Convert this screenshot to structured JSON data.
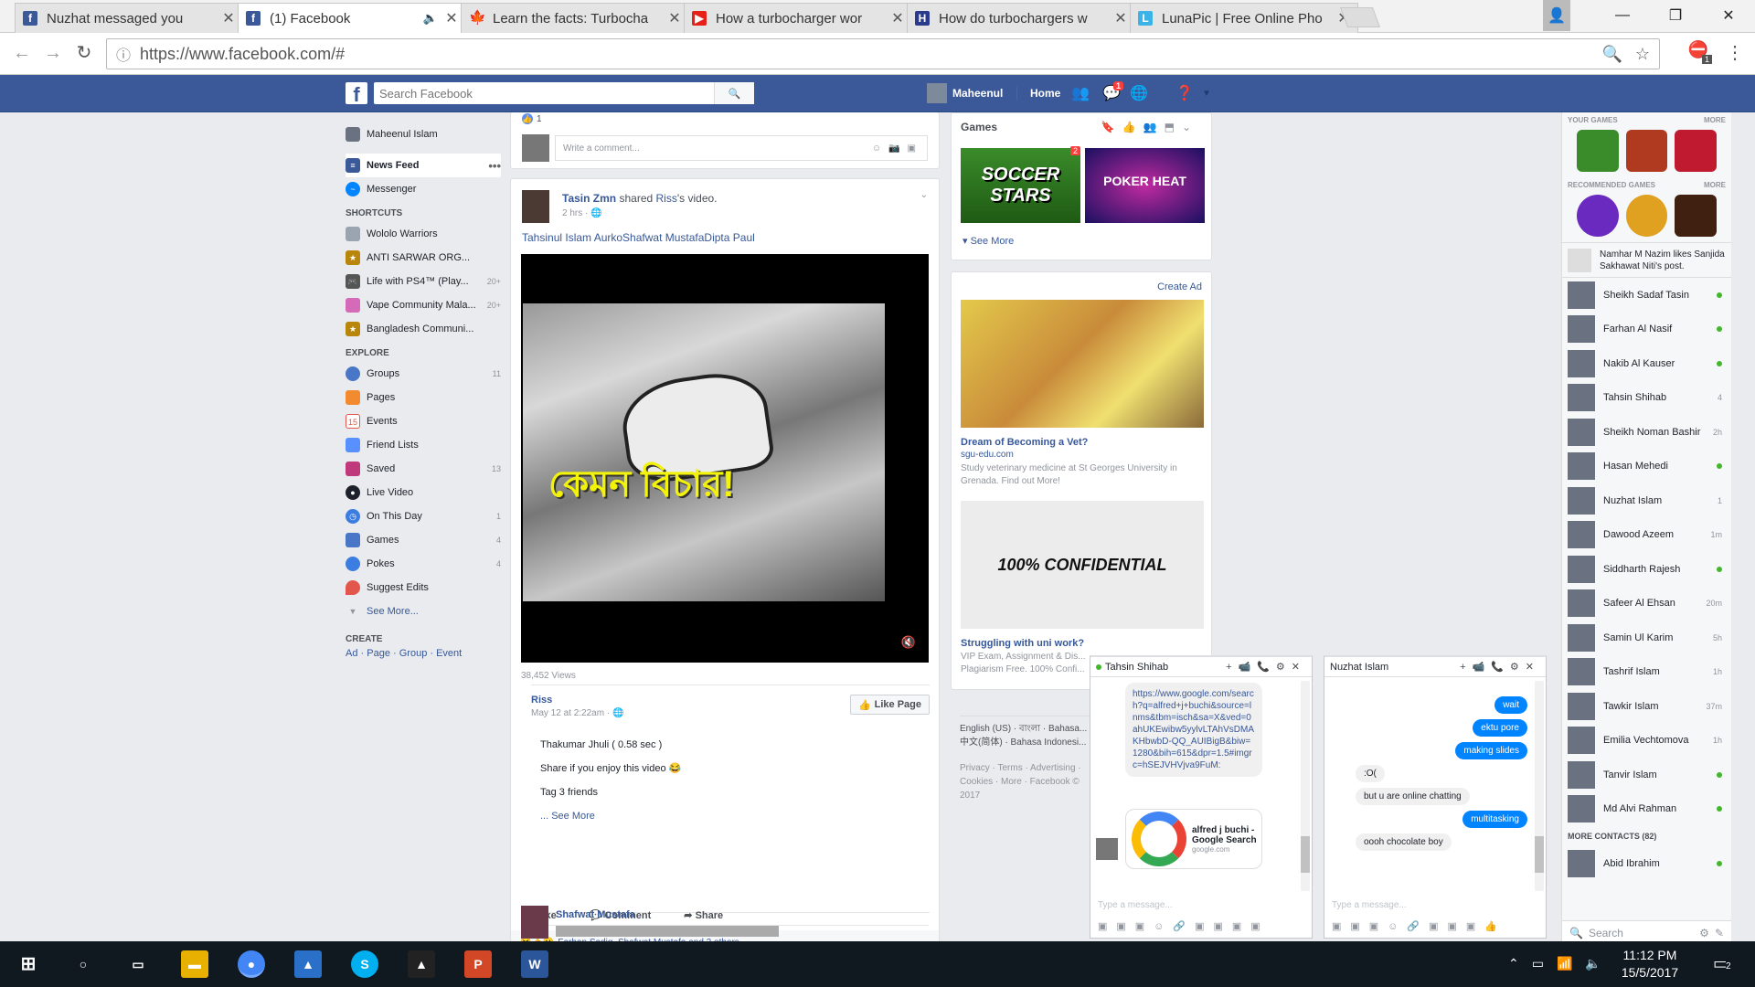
{
  "browser": {
    "tabs": [
      {
        "title": "Nuzhat messaged you",
        "icon": "facebook-icon"
      },
      {
        "title": "(1) Facebook",
        "icon": "facebook-icon",
        "active": true
      },
      {
        "title": "Learn the facts: Turbocha",
        "icon": "maple-leaf-icon"
      },
      {
        "title": "How a turbocharger wor",
        "icon": "youtube-icon"
      },
      {
        "title": "How do turbochargers w",
        "icon": "hsw-icon"
      },
      {
        "title": "LunaPic | Free Online Pho",
        "icon": "lunapic-icon"
      }
    ],
    "url": "https://www.facebook.com/#",
    "extension_badge": "1"
  },
  "fb": {
    "search_placeholder": "Search Facebook",
    "user": "Maheenul",
    "home": "Home",
    "msg_badge": "1"
  },
  "left": {
    "profile": "Maheenul Islam",
    "news_feed": "News Feed",
    "messenger": "Messenger",
    "shortcuts_head": "SHORTCUTS",
    "shortcuts": [
      {
        "label": "Wololo Warriors",
        "count": ""
      },
      {
        "label": "ANTI SARWAR ORG...",
        "count": ""
      },
      {
        "label": "Life with PS4™ (Play...",
        "count": "20+"
      },
      {
        "label": "Vape Community Mala...",
        "count": "20+"
      },
      {
        "label": "Bangladesh Communi...",
        "count": ""
      }
    ],
    "explore_head": "EXPLORE",
    "explore": [
      {
        "label": "Groups",
        "count": "11",
        "color": "#4a76c7"
      },
      {
        "label": "Pages",
        "count": "",
        "color": "#f28a30"
      },
      {
        "label": "Events",
        "count": "",
        "color": "#e2564b"
      },
      {
        "label": "Friend Lists",
        "count": "",
        "color": "#5890ff"
      },
      {
        "label": "Saved",
        "count": "13",
        "color": "#c0397c"
      },
      {
        "label": "Live Video",
        "count": "",
        "color": "#1d2129"
      },
      {
        "label": "On This Day",
        "count": "1",
        "color": "#3b7de0"
      },
      {
        "label": "Games",
        "count": "4",
        "color": "#4a76c7"
      },
      {
        "label": "Pokes",
        "count": "4",
        "color": "#3b7de0"
      },
      {
        "label": "Suggest Edits",
        "count": "",
        "color": "#e2564b"
      }
    ],
    "see_more": "See More...",
    "create_head": "CREATE",
    "create_links": [
      "Ad",
      "Page",
      "Group",
      "Event"
    ]
  },
  "post": {
    "prev_likes": "1",
    "comment_placeholder": "Write a comment...",
    "author": "Tasin Zmn",
    "shared": "shared",
    "source": "Riss",
    "source_suffix": "'s video.",
    "time": "2 hrs",
    "tags": "Tahsinul Islam AurkoShafwat MustafaDipta Paul",
    "video_caption": "কেমন বিচার!",
    "views": "38,452 Views",
    "page_name": "Riss",
    "page_time": "May 12 at 2:22am",
    "like_page": "Like Page",
    "desc": [
      "Thakumar Jhuli ( 0.58 sec )",
      "Share if you enjoy this video 😂",
      "Tag 3 friends"
    ],
    "see_more": "... See More",
    "actions": [
      "Like",
      "Comment",
      "Share"
    ],
    "reactions": "Farhan Sadiq, Shafwat Mustafa and 2 others",
    "commenter": "Shafwat Mustafa"
  },
  "right": {
    "games_title": "Games",
    "game1": "SOCCER STARS",
    "game2": "POKER HEAT",
    "games_see_more": "See More",
    "create_ad": "Create Ad",
    "ad1_title": "Dream of Becoming a Vet?",
    "ad1_domain": "sgu-edu.com",
    "ad1_text": "Study veterinary medicine at St Georges University in Grenada. Find out More!",
    "ad2_img_text": "100% CONFIDENTIAL",
    "ad2_title": "Struggling with uni work?",
    "ad2_text": "VIP Exam, Assignment & Dis... Plagiarism Free. 100% Confi...",
    "langs": "English (US) · বাংলা · Bahasa... 中文(简体) · Bahasa Indonesi...",
    "footer": "Privacy · Terms · Advertising · Cookies · More · Facebook © 2017"
  },
  "sidebar": {
    "your_games": "YOUR GAMES",
    "recommended": "RECOMMENDED GAMES",
    "more": "MORE",
    "ticker": "Namhar M Nazim likes Sanjida Sakhawat Niti's post.",
    "contacts": [
      {
        "name": "Sheikh Sadaf Tasin",
        "status": "online"
      },
      {
        "name": "Farhan Al Nasif",
        "status": "online"
      },
      {
        "name": "Nakib Al Kauser",
        "status": "online"
      },
      {
        "name": "Tahsin Shihab",
        "status": "4"
      },
      {
        "name": "Sheikh Noman Bashir",
        "status": "2h"
      },
      {
        "name": "Hasan Mehedi",
        "status": "online"
      },
      {
        "name": "Nuzhat Islam",
        "status": "1"
      },
      {
        "name": "Dawood Azeem",
        "status": "1m"
      },
      {
        "name": "Siddharth Rajesh",
        "status": "online"
      },
      {
        "name": "Safeer Al Ehsan",
        "status": "20m"
      },
      {
        "name": "Samin Ul Karim",
        "status": "5h"
      },
      {
        "name": "Tashrif Islam",
        "status": "1h"
      },
      {
        "name": "Tawkir Islam",
        "status": "37m"
      },
      {
        "name": "Emilia Vechtomova",
        "status": "1h"
      },
      {
        "name": "Tanvir Islam",
        "status": "online"
      },
      {
        "name": "Md Alvi Rahman",
        "status": "online"
      }
    ],
    "more_contacts": "MORE CONTACTS (82)",
    "extra_contact": "Abid Ibrahim",
    "search": "Search"
  },
  "chat1": {
    "name": "Tahsin Shihab",
    "link": "https://www.google.com/search?q=alfred+j+buchi&source=lnms&tbm=isch&sa=X&ved=0ahUKEwibw5yylvLTAhVsDMAKHbwbD-QQ_AUIBigB&biw=1280&bih=615&dpr=1.5#imgrc=hSEJVHVjva9FuM:",
    "card_title": "alfred j buchi - Google Search",
    "card_domain": "google.com",
    "input": "Type a message..."
  },
  "chat2": {
    "name": "Nuzhat Islam",
    "messages": [
      {
        "from": "me",
        "text": "wait"
      },
      {
        "from": "me",
        "text": "ektu pore"
      },
      {
        "from": "me",
        "text": "making slides"
      },
      {
        "from": "them",
        "text": ":O("
      },
      {
        "from": "them",
        "text": "but u are online chatting"
      },
      {
        "from": "me",
        "text": "multitasking"
      },
      {
        "from": "them",
        "text": "oooh chocolate boy"
      }
    ],
    "input": "Type a message..."
  },
  "taskbar": {
    "time": "11:12 PM",
    "date": "15/5/2017",
    "notif": "2"
  }
}
